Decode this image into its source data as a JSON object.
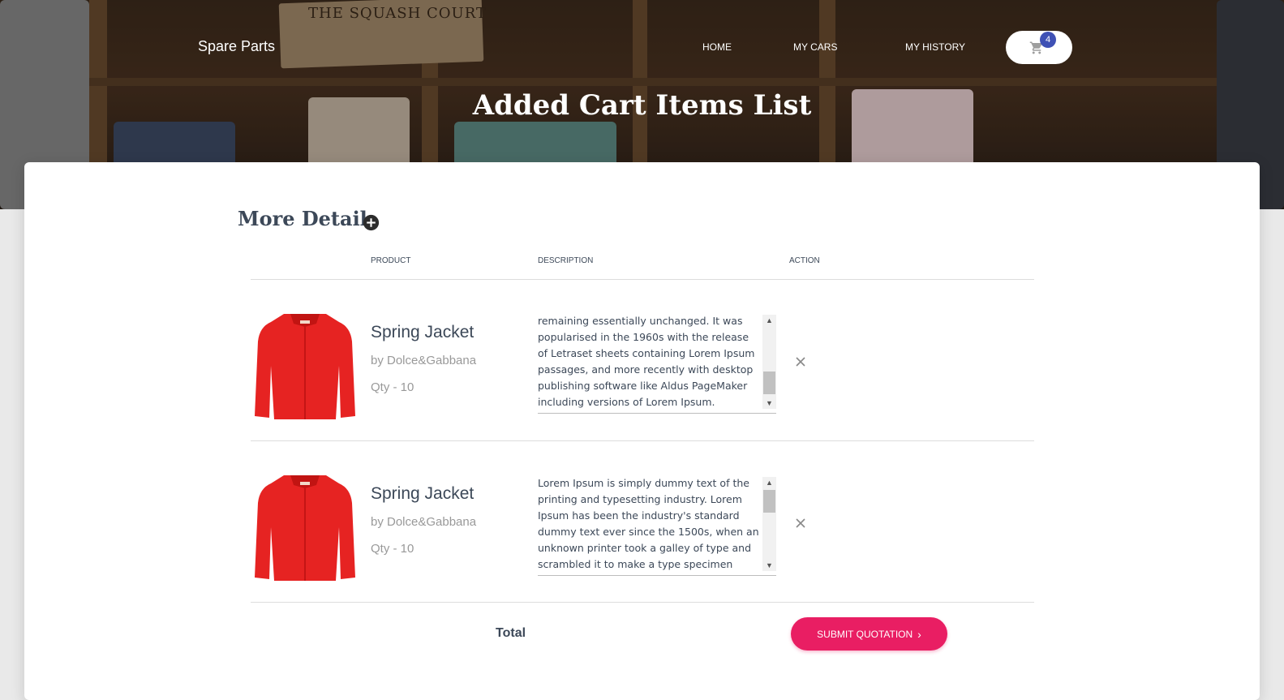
{
  "header": {
    "brand": "Spare Parts",
    "nav": [
      {
        "label": "HOME"
      },
      {
        "label": "MY CARS"
      },
      {
        "label": "MY HISTORY"
      }
    ],
    "cart_count": "4",
    "tag_text": "THE SQUASH COURT"
  },
  "page_title": "Added Cart Items List",
  "section_title": "More Detail",
  "table": {
    "columns": [
      "PRODUCT",
      "DESCRIPTION",
      "ACTION"
    ],
    "rows": [
      {
        "name": "Spring Jacket",
        "brand": "by Dolce&Gabbana",
        "qty": "Qty - 10",
        "description": "remaining essentially unchanged. It was popularised in the 1960s with the release of Letraset sheets containing Lorem Ipsum passages, and more recently with desktop publishing software like Aldus PageMaker including versions of Lorem Ipsum."
      },
      {
        "name": "Spring Jacket",
        "brand": "by Dolce&Gabbana",
        "qty": "Qty - 10",
        "description": "Lorem Ipsum is simply dummy text of the printing and typesetting industry. Lorem Ipsum has been the industry's standard dummy text ever since the 1500s, when an unknown printer took a galley of type and scrambled it to make a type specimen book."
      }
    ]
  },
  "footer": {
    "total_label": "Total",
    "submit_label": "SUBMIT QUOTATION"
  },
  "colors": {
    "accent": "#e91e63",
    "badge": "#3f51b5",
    "text_dark": "#3c4858"
  },
  "icons": {
    "cart": "shopping-cart-icon",
    "add": "plus-circle-icon",
    "remove": "close-icon",
    "chevron": "chevron-right-icon"
  }
}
